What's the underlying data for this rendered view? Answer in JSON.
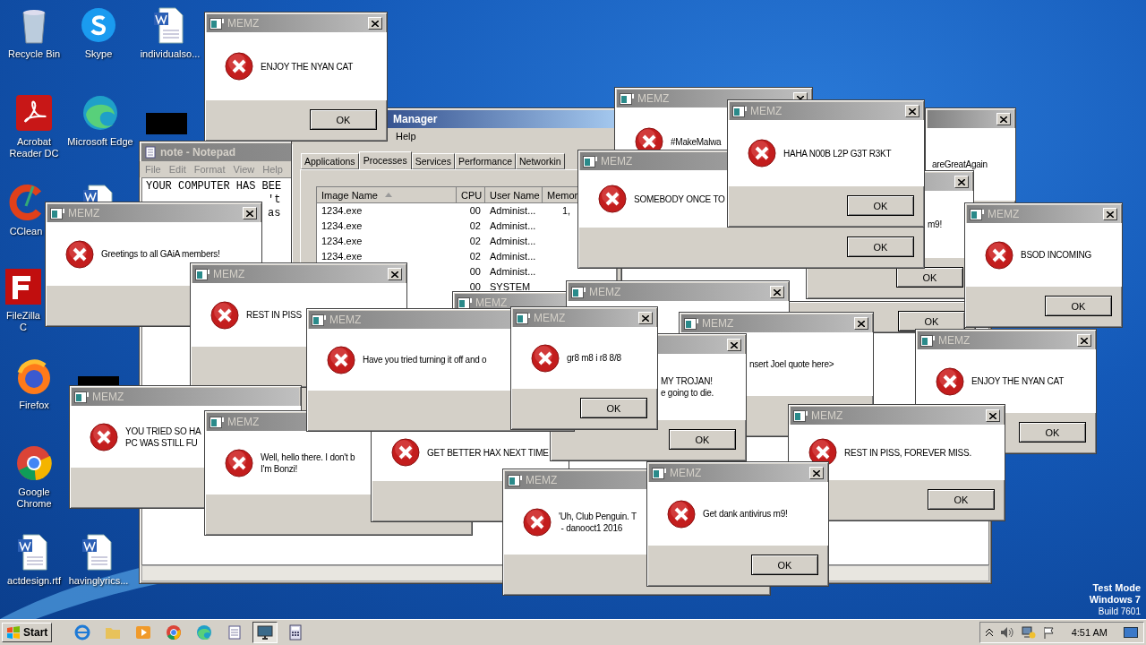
{
  "desktop_icons": [
    {
      "kind": "bin",
      "label": "Recycle Bin"
    },
    {
      "kind": "skype",
      "label": "Skype"
    },
    {
      "kind": "word",
      "label": "individualso..."
    },
    {
      "kind": "acrobat",
      "label": "Acrobat Reader DC"
    },
    {
      "kind": "edge",
      "label": "Microsoft Edge"
    },
    {
      "kind": "thumbnail"
    },
    {
      "kind": "ccleaner",
      "label": "CClean"
    },
    {
      "kind": "word"
    },
    {
      "kind": "filezilla",
      "label": "FileZilla C"
    },
    {
      "kind": "thumbnail"
    },
    {
      "kind": "firefox",
      "label": "Firefox"
    },
    {
      "kind": "chrome",
      "label": "Google Chrome"
    },
    {
      "kind": "word",
      "label": "actdesign.rtf"
    },
    {
      "kind": "word",
      "label": "havinglyrics..."
    }
  ],
  "notepad": {
    "title": "note - Notepad",
    "menu": [
      "File",
      "Edit",
      "Format",
      "View",
      "Help"
    ],
    "lines": [
      "YOUR COMPUTER HAS BEE",
      "'t",
      "as"
    ]
  },
  "task_manager": {
    "title": "Manager",
    "menu": [
      "Help"
    ],
    "tabs": [
      {
        "label": "Applications",
        "selected": false
      },
      {
        "label": "Processes",
        "selected": true
      },
      {
        "label": "Services",
        "selected": false
      },
      {
        "label": "Performance",
        "selected": false
      },
      {
        "label": "Networkin",
        "selected": false
      }
    ],
    "columns": [
      "Image Name",
      "CPU",
      "User Name",
      "Memor"
    ],
    "rows": [
      {
        "image": "1234.exe",
        "cpu": "00",
        "user": "Administ...",
        "memory": "1,"
      },
      {
        "image": "1234.exe",
        "cpu": "02",
        "user": "Administ..."
      },
      {
        "image": "1234.exe",
        "cpu": "02",
        "user": "Administ..."
      },
      {
        "image": "1234.exe",
        "cpu": "02",
        "user": "Administ..."
      },
      {
        "cpu": "00",
        "user": "Administ..."
      },
      {
        "cpu": "00",
        "user": "SYSTEM"
      }
    ]
  },
  "dialogs": [
    {
      "title": "MEMZ",
      "message": [
        "Greetings to all GAiA members!"
      ]
    },
    {
      "title": "MEMZ",
      "message": [
        "ENJOY THE NYAN CAT"
      ],
      "button": "OK"
    },
    {
      "title": "MEMZ",
      "message": [
        "#MakeMalwa"
      ]
    },
    {
      "message": [
        "areGreatAgain"
      ]
    },
    {
      "message": [
        "m9!"
      ],
      "button": "OK"
    },
    {
      "button": "OK"
    },
    {
      "title": "MEMZ",
      "message": [
        "SOMEBODY ONCE TO"
      ],
      "button": "OK"
    },
    {
      "title": "MEMZ",
      "message": [
        "HAHA N00B L2P G3T R3KT"
      ],
      "button": "OK"
    },
    {
      "title": "MEMZ",
      "message": [
        "BSOD INCOMING"
      ],
      "button": "OK"
    },
    {
      "title": "MEMZ",
      "message": [
        "REST IN PISS"
      ]
    },
    {
      "title": "MEMZ",
      "message": [
        "YOU TRIED SO HA",
        "PC WAS STILL FU"
      ]
    },
    {
      "title": "MEMZ",
      "message": [
        "Well, hello there. I don't b",
        "I'm Bonzi!"
      ]
    },
    {
      "title": "MEMZ"
    },
    {
      "message": [
        "GET BETTER HAX NEXT TIME"
      ]
    },
    {
      "title": "MEMZ"
    },
    {
      "title": "MEMZ",
      "message": [
        "nsert Joel quote here>"
      ]
    },
    {
      "message": [
        "MY TROJAN!",
        "e going to die."
      ],
      "button": "OK"
    },
    {
      "title": "MEMZ",
      "message": [
        "Have you tried turning it off and o"
      ]
    },
    {
      "title": "MEMZ",
      "message": [
        "gr8 m8 i r8 8/8"
      ],
      "button": "OK"
    },
    {
      "title": "MEMZ",
      "message": [
        "ENJOY THE NYAN CAT"
      ],
      "button": "OK"
    },
    {
      "title": "MEMZ",
      "message": [
        "REST IN PISS, FOREVER MISS."
      ],
      "button": "OK"
    },
    {
      "title": "MEMZ",
      "message": [
        "'Uh, Club Penguin. T",
        " - danooct1 2016"
      ]
    },
    {
      "title": "MEMZ",
      "message": [
        "Get dank antivirus m9!"
      ],
      "button": "OK"
    }
  ],
  "system_text": [
    "Test Mode",
    "Windows 7",
    "Build 7601"
  ],
  "taskbar": {
    "start": "Start",
    "apps": [
      {
        "kind": "ie",
        "selected": false
      },
      {
        "kind": "folder",
        "selected": false
      },
      {
        "kind": "media",
        "selected": false
      },
      {
        "kind": "chrome",
        "selected": false
      },
      {
        "kind": "edge",
        "selected": false
      },
      {
        "kind": "notepad",
        "selected": false
      },
      {
        "kind": "monitor",
        "selected": true
      },
      {
        "kind": "calculator",
        "selected": false
      }
    ],
    "clock": "4:51 AM"
  }
}
